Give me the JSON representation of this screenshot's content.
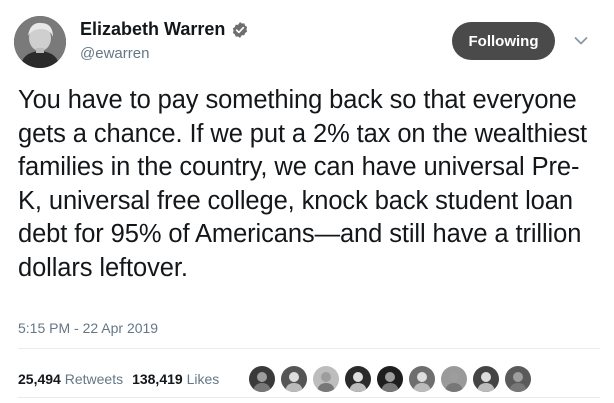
{
  "author": {
    "name": "Elizabeth Warren",
    "handle": "@ewarren",
    "avatar_icon": "profile-photo",
    "verified_icon": "verified-badge-icon"
  },
  "follow_button": {
    "label": "Following"
  },
  "menu": {
    "icon": "chevron-down-icon"
  },
  "tweet": {
    "text": "You have to pay something back so that everyone gets a chance. If we put a 2% tax on the wealthiest families in the country, we can have universal Pre-K, universal free college, knock back student loan debt for 95% of Americans—and still have a trillion dollars leftover.",
    "timestamp": "5:15 PM - 22 Apr 2019"
  },
  "stats": {
    "retweets_count": "25,494",
    "retweets_label": "Retweets",
    "likes_count": "138,419",
    "likes_label": "Likes"
  },
  "likers": [
    {
      "shade": "#3a3a3a"
    },
    {
      "shade": "#555555"
    },
    {
      "shade": "#bdbdbd"
    },
    {
      "shade": "#2a2a2a"
    },
    {
      "shade": "#1e1e1e"
    },
    {
      "shade": "#6e6e6e"
    },
    {
      "shade": "#9a9a9a"
    },
    {
      "shade": "#444444"
    },
    {
      "shade": "#5a5a5a"
    }
  ],
  "colors": {
    "text_primary": "#14171a",
    "text_secondary": "#657786",
    "button_bg": "#4a4a4a",
    "verified_badge": "#6e6e6e"
  }
}
